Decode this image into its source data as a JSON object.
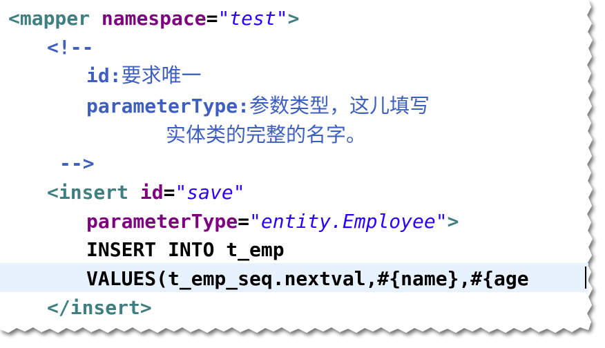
{
  "lines": {
    "mapper_open": {
      "tag_start": "<mapper",
      "attr": "namespace",
      "eq": "=",
      "value": "\"test\"",
      "tag_end": ">"
    },
    "comment_open": "<!--",
    "comment_id_key": "id:",
    "comment_id_text": "要求唯一",
    "comment_pt_key": "parameterType:",
    "comment_pt_text": "参数类型，这儿填写",
    "comment_pt_text2": "实体类的完整的名字。",
    "comment_close": "-->",
    "insert_open": {
      "tag_start": "<insert",
      "attr": "id",
      "eq": "=",
      "value": "\"save\""
    },
    "parameter_type": {
      "attr": "parameterType",
      "eq": "=",
      "value": "\"entity.Employee\"",
      "tag_end": ">"
    },
    "sql_insert": "INSERT INTO t_emp",
    "sql_values": "VALUES(t_emp_seq.nextval,#{name},#{age",
    "insert_close": "</insert>"
  },
  "colors": {
    "tag": "#3f7f7f",
    "attribute": "#7f007f",
    "value": "#2a00ff",
    "comment": "#3f5fbf",
    "current_line": "#e8f2fe"
  }
}
